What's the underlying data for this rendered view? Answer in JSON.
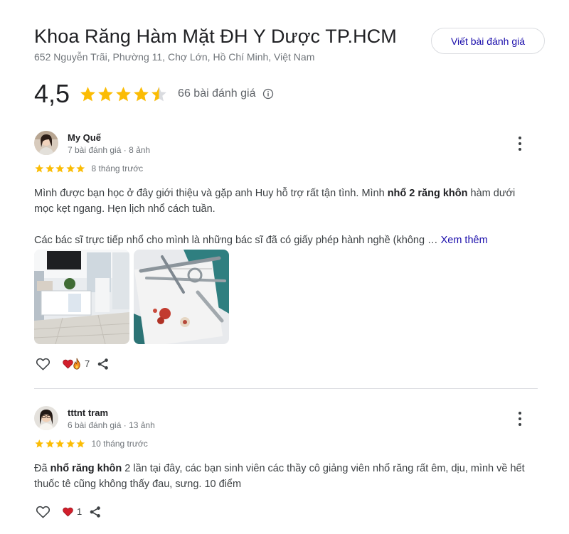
{
  "place": {
    "title": "Khoa Răng Hàm Mặt ĐH Y Dược TP.HCM",
    "address": "652 Nguyễn Trãi, Phường 11, Chợ Lớn, Hồ Chí Minh, Việt Nam",
    "write_review_label": "Viết bài đánh giá"
  },
  "rating": {
    "value": "4,5",
    "stars": 4.5,
    "count_label": "66 bài đánh giá",
    "star_color": "#fbbc04"
  },
  "reviews": [
    {
      "name": "My Quế",
      "meta": "7 bài đánh giá · 8 ảnh",
      "stars": 5,
      "time": "8 tháng trước",
      "text_1_before": "Mình được bạn học ở đây giới thiệu và gặp anh Huy hỗ trợ rất tận tình. Mình ",
      "text_1_bold": "nhổ 2 răng khôn",
      "text_1_after": " hàm dưới mọc kẹt ngang. Hẹn lịch nhổ cách tuần.",
      "text_2": "Các bác sĩ trực tiếp nhổ cho mình là những bác sĩ đã có giấy phép hành nghề (không … ",
      "see_more": "Xem thêm",
      "reaction_count": "7"
    },
    {
      "name": "tttnt tram",
      "meta": "6 bài đánh giá · 13 ảnh",
      "stars": 5,
      "time": "10 tháng trước",
      "text_before": "Đã ",
      "text_bold": "nhổ răng khôn",
      "text_after": " 2 lần tại đây, các bạn sinh viên các thầy cô giảng viên nhổ răng rất êm, dịu, mình về hết thuốc tê cũng không thấy đau, sưng. 10 điểm",
      "reaction_count": "1"
    }
  ]
}
